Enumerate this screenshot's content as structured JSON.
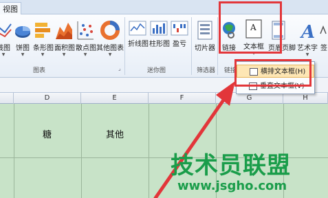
{
  "ribbon": {
    "active_tab": "视图",
    "buttons": {
      "line": "线图",
      "pie": "饼图",
      "bar": "条形图",
      "area": "面积图",
      "scatter": "散点图",
      "other": "其他图表",
      "sparkline_line": "折线图",
      "sparkline_column": "柱形图",
      "sparkline_winloss": "盈亏",
      "slicer": "切片器",
      "hyperlink": "链接",
      "textbox": "文本框",
      "header_footer": "页眉页脚",
      "wordart": "艺术字",
      "signature": "签"
    },
    "groups": {
      "charts": "图表",
      "sparklines": "迷你图",
      "filter": "筛选器",
      "links": "链接"
    }
  },
  "dropdown": {
    "items": [
      "横排文本框(H)",
      "垂直文本框(V)"
    ]
  },
  "sheet": {
    "columns": [
      "D",
      "E",
      "F",
      "G",
      "H"
    ],
    "cells": {
      "d_header": "糖",
      "e_header": "其他"
    }
  },
  "watermark": {
    "title": "技术员联盟",
    "url": "www.jsgho.com"
  },
  "colors": {
    "annotation": "#e2363a",
    "grid": "#c8e3c8",
    "watermark": "#1a9d4a"
  }
}
